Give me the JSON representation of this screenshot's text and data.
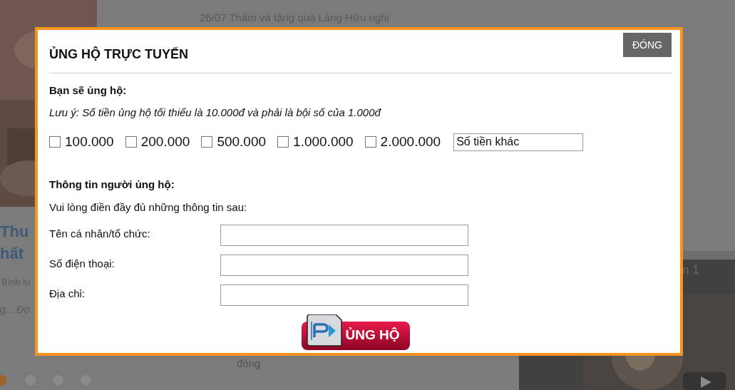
{
  "background": {
    "headline": "26/07  Thăm và tặng quà Làng Hữu nghị",
    "story_title_lines": [
      "Thu",
      "hất"
    ],
    "story_meta": "Bình lu",
    "story_excerpt": "g... Đọ",
    "slider_dots": [
      {
        "selected": true
      },
      {
        "selected": false
      },
      {
        "selected": false
      },
      {
        "selected": false
      }
    ],
    "side_label": "n 1",
    "footer_text": "đóng"
  },
  "dialog": {
    "title": "ỦNG HỘ TRỰC TUYẾN",
    "close_button": "ĐÓNG",
    "amount_heading": "Bạn sẽ ủng hộ:",
    "note": "Lưu ý: Số tiền ủng hộ tối thiểu là 10.000đ và phải là bội số của 1.000đ",
    "amounts": [
      {
        "label": "100.000",
        "checked": false
      },
      {
        "label": "200.000",
        "checked": false
      },
      {
        "label": "500.000",
        "checked": false
      },
      {
        "label": "1.000.000",
        "checked": false
      },
      {
        "label": "2.000.000",
        "checked": false
      }
    ],
    "other_amount": {
      "placeholder": "Số tiền khác"
    },
    "donor_heading": "Thông tin người ủng hộ:",
    "donor_hint": "Vui lòng điền đầy đủ những thông tin sau:",
    "fields": [
      {
        "label": "Tên cá nhân/tổ chức:"
      },
      {
        "label": "Số điện thoại:"
      },
      {
        "label": "Địa chỉ:"
      }
    ],
    "submit_button": "ỦNG HỘ"
  }
}
